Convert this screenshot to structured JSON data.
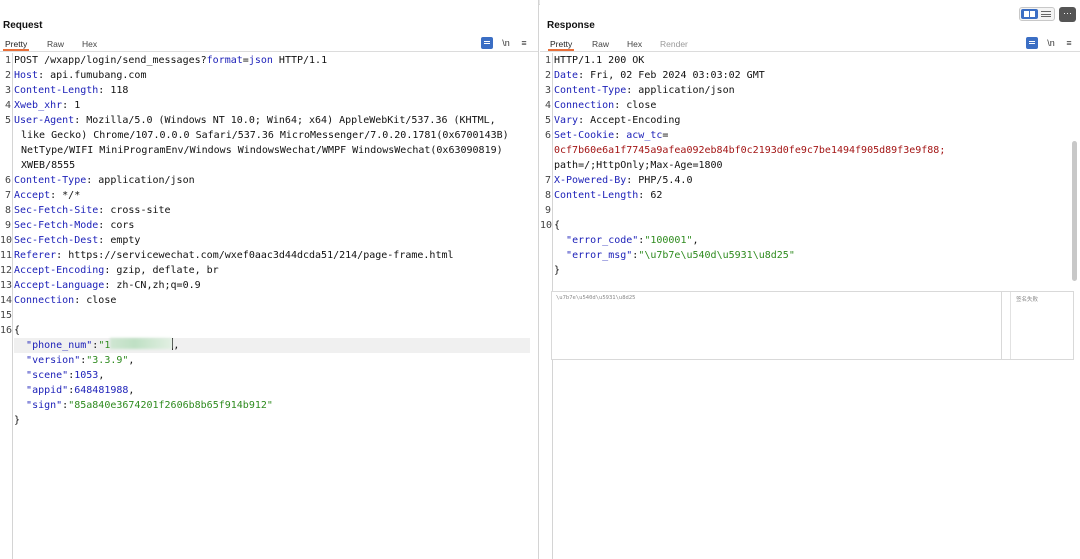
{
  "request": {
    "title": "Request",
    "tabs": [
      {
        "label": "Pretty",
        "active": true
      },
      {
        "label": "Raw",
        "active": false
      },
      {
        "label": "Hex",
        "active": false
      }
    ],
    "icons": [
      "pretty-print-icon",
      "newline-toggle-icon",
      "menu-icon"
    ],
    "newline_label": "\\n",
    "menu_glyph": "≡",
    "lines": [
      {
        "n": "1",
        "parts": [
          [
            "POST /wxapp/login/send_messages?",
            ""
          ],
          [
            "format",
            "k"
          ],
          [
            "=",
            ""
          ],
          [
            "json",
            "k"
          ],
          [
            " HTTP/1.1",
            ""
          ]
        ]
      },
      {
        "n": "2",
        "parts": [
          [
            "Host",
            "k"
          ],
          [
            ": api.fumubang.com",
            ""
          ]
        ]
      },
      {
        "n": "3",
        "parts": [
          [
            "Content-Length",
            "k"
          ],
          [
            ": 118",
            ""
          ]
        ]
      },
      {
        "n": "4",
        "parts": [
          [
            "Xweb_xhr",
            "k"
          ],
          [
            ": 1",
            ""
          ]
        ]
      },
      {
        "n": "5",
        "parts": [
          [
            "User-Agent",
            "k"
          ],
          [
            ": Mozilla/5.0 (Windows NT 10.0; Win64; x64) AppleWebKit/537.36 (KHTML,",
            ""
          ]
        ]
      },
      {
        "n": "",
        "cont": true,
        "parts": [
          [
            "like Gecko) Chrome/107.0.0.0 Safari/537.36 MicroMessenger/7.0.20.1781(0x6700143B)",
            ""
          ]
        ]
      },
      {
        "n": "",
        "cont": true,
        "parts": [
          [
            "NetType/WIFI MiniProgramEnv/Windows WindowsWechat/WMPF WindowsWechat(0x63090819)",
            ""
          ]
        ]
      },
      {
        "n": "",
        "cont": true,
        "parts": [
          [
            "XWEB/8555",
            ""
          ]
        ]
      },
      {
        "n": "6",
        "parts": [
          [
            "Content-Type",
            "k"
          ],
          [
            ": application/json",
            ""
          ]
        ]
      },
      {
        "n": "7",
        "parts": [
          [
            "Accept",
            "k"
          ],
          [
            ": */*",
            ""
          ]
        ]
      },
      {
        "n": "8",
        "parts": [
          [
            "Sec-Fetch-Site",
            "k"
          ],
          [
            ": cross-site",
            ""
          ]
        ]
      },
      {
        "n": "9",
        "parts": [
          [
            "Sec-Fetch-Mode",
            "k"
          ],
          [
            ": cors",
            ""
          ]
        ]
      },
      {
        "n": "10",
        "parts": [
          [
            "Sec-Fetch-Dest",
            "k"
          ],
          [
            ": empty",
            ""
          ]
        ]
      },
      {
        "n": "11",
        "parts": [
          [
            "Referer",
            "k"
          ],
          [
            ": https://servicewechat.com/wxef0aac3d44dcda51/214/page-frame.html",
            ""
          ]
        ]
      },
      {
        "n": "12",
        "parts": [
          [
            "Accept-Encoding",
            "k"
          ],
          [
            ": gzip, deflate, br",
            ""
          ]
        ]
      },
      {
        "n": "13",
        "parts": [
          [
            "Accept-Language",
            "k"
          ],
          [
            ": zh-CN,zh;q=0.9",
            ""
          ]
        ]
      },
      {
        "n": "14",
        "parts": [
          [
            "Connection",
            "k"
          ],
          [
            ": close",
            ""
          ]
        ]
      },
      {
        "n": "15",
        "parts": []
      },
      {
        "n": "16",
        "parts": [
          [
            "{",
            ""
          ]
        ]
      },
      {
        "n": "",
        "parts": [
          [
            "  ",
            ""
          ],
          [
            "\"phone_num\"",
            "jk"
          ],
          [
            ":",
            ""
          ],
          [
            "\"1",
            "s"
          ],
          [
            "__REDACT__",
            ""
          ],
          [
            "__CURSOR__",
            ""
          ],
          [
            ",",
            ""
          ]
        ],
        "highlight": true
      },
      {
        "n": "",
        "parts": [
          [
            "  ",
            ""
          ],
          [
            "\"version\"",
            "jk"
          ],
          [
            ":",
            ""
          ],
          [
            "\"3.3.9\"",
            "s"
          ],
          [
            ",",
            ""
          ]
        ]
      },
      {
        "n": "",
        "parts": [
          [
            "  ",
            ""
          ],
          [
            "\"scene\"",
            "jk"
          ],
          [
            ":",
            ""
          ],
          [
            "1053",
            "num"
          ],
          [
            ",",
            ""
          ]
        ]
      },
      {
        "n": "",
        "parts": [
          [
            "  ",
            ""
          ],
          [
            "\"appid\"",
            "jk"
          ],
          [
            ":",
            ""
          ],
          [
            "648481988",
            "num"
          ],
          [
            ",",
            ""
          ]
        ]
      },
      {
        "n": "",
        "parts": [
          [
            "  ",
            ""
          ],
          [
            "\"sign\"",
            "jk"
          ],
          [
            ":",
            ""
          ],
          [
            "\"85a840e3674201f2606b8b65f914b912\"",
            "s"
          ]
        ]
      },
      {
        "n": "",
        "parts": [
          [
            "}",
            ""
          ]
        ]
      }
    ]
  },
  "response": {
    "title": "Response",
    "tabs": [
      {
        "label": "Pretty",
        "active": true
      },
      {
        "label": "Raw",
        "active": false
      },
      {
        "label": "Hex",
        "active": false
      },
      {
        "label": "Render",
        "active": false,
        "disabled": true
      }
    ],
    "newline_label": "\\n",
    "menu_glyph": "≡",
    "lines": [
      {
        "n": "1",
        "parts": [
          [
            "HTTP/1.1 200 OK",
            ""
          ]
        ]
      },
      {
        "n": "2",
        "parts": [
          [
            "Date",
            "k"
          ],
          [
            ": Fri, 02 Feb 2024 03:03:02 GMT",
            ""
          ]
        ]
      },
      {
        "n": "3",
        "parts": [
          [
            "Content-Type",
            "k"
          ],
          [
            ": application/json",
            ""
          ]
        ]
      },
      {
        "n": "4",
        "parts": [
          [
            "Connection",
            "k"
          ],
          [
            ": close",
            ""
          ]
        ]
      },
      {
        "n": "5",
        "parts": [
          [
            "Vary",
            "k"
          ],
          [
            ": Accept-Encoding",
            ""
          ]
        ]
      },
      {
        "n": "6",
        "parts": [
          [
            "Set-Cookie",
            "k"
          ],
          [
            ": ",
            ""
          ],
          [
            "acw_tc",
            "k"
          ],
          [
            "=",
            ""
          ]
        ]
      },
      {
        "n": "",
        "cont0": true,
        "parts": [
          [
            "0cf7b60e6a1f7745a9afea092eb84bf0c2193d0fe9c7be1494f905d89f3e9f88;",
            "cookie"
          ]
        ]
      },
      {
        "n": "",
        "cont0": true,
        "parts": [
          [
            "path=/;HttpOnly;Max-Age=1800",
            ""
          ]
        ]
      },
      {
        "n": "7",
        "parts": [
          [
            "X-Powered-By",
            "k"
          ],
          [
            ": PHP/5.4.0",
            ""
          ]
        ]
      },
      {
        "n": "8",
        "parts": [
          [
            "Content-Length",
            "k"
          ],
          [
            ": 62",
            ""
          ]
        ]
      },
      {
        "n": "9",
        "parts": []
      },
      {
        "n": "10",
        "parts": [
          [
            "{",
            ""
          ]
        ]
      },
      {
        "n": "",
        "parts": [
          [
            "  ",
            ""
          ],
          [
            "\"error_code\"",
            "jk"
          ],
          [
            ":",
            ""
          ],
          [
            "\"100001\"",
            "s"
          ],
          [
            ",",
            ""
          ]
        ]
      },
      {
        "n": "",
        "parts": [
          [
            "  ",
            ""
          ],
          [
            "\"error_msg\"",
            "jk"
          ],
          [
            ":",
            ""
          ],
          [
            "\"\\u7b7e\\u540d\\u5931\\u8d25\"",
            "s"
          ]
        ]
      },
      {
        "n": "",
        "parts": [
          [
            "}",
            ""
          ]
        ]
      }
    ],
    "decoded_input": "\\u7b7e\\u540d\\u5931\\u8d25",
    "decoded_output": "签名失败"
  },
  "layout_switch": {
    "icons": [
      "split-view-icon",
      "stacked-view-icon"
    ]
  },
  "more_button": "⋯"
}
